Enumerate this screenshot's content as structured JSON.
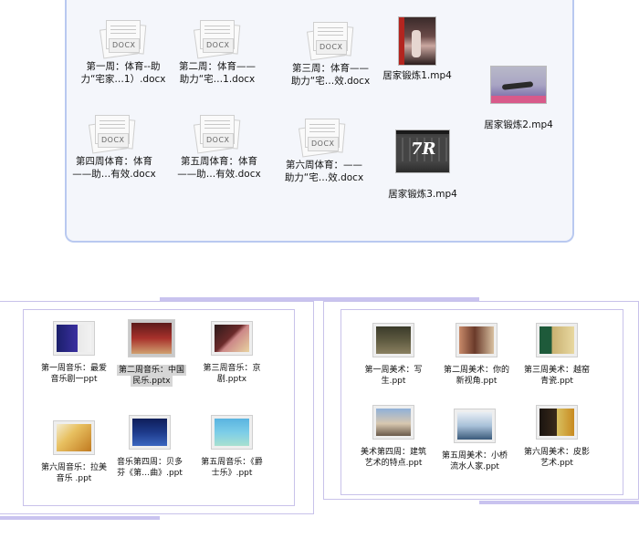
{
  "top_files": [
    {
      "name": "docx-file-week1",
      "tag": "DOCX",
      "label_line1": "第一周：体育--助",
      "label_line2": "力“宅家…1）.docx"
    },
    {
      "name": "docx-file-week2",
      "tag": "DOCX",
      "label_line1": "第二周：体育——",
      "label_line2": "助力“宅…1.docx"
    },
    {
      "name": "docx-file-week3",
      "tag": "DOCX",
      "label_line1": "第三周：体育——",
      "label_line2": "助力“宅…效.docx"
    },
    {
      "name": "docx-file-week4",
      "tag": "DOCX",
      "label_line1": "第四周体育：体育",
      "label_line2": "——助…有效.docx"
    },
    {
      "name": "docx-file-week5",
      "tag": "DOCX",
      "label_line1": "第五周体育：体育",
      "label_line2": "——助…有效.docx"
    },
    {
      "name": "docx-file-week6",
      "tag": "DOCX",
      "label_line1": "第六周体育：——",
      "label_line2": "助力“宅…效.docx"
    }
  ],
  "videos": [
    {
      "label": "居家锻炼1.mp4"
    },
    {
      "label": "居家锻炼2.mp4"
    },
    {
      "label": "居家锻炼3.mp4",
      "logo": "7R"
    }
  ],
  "music_files": [
    {
      "line1": "第一周音乐：最爱",
      "line2": "音乐剧一ppt"
    },
    {
      "line1": "第二周音乐：中国",
      "line2": "民乐.pptx"
    },
    {
      "line1": "第三周音乐：京",
      "line2": "剧.pptx"
    },
    {
      "line1": "第六周音乐：拉美",
      "line2": "音乐 .ppt"
    },
    {
      "line1": "音乐第四周：贝多",
      "line2": "芬《第…曲》.ppt"
    },
    {
      "line1": "第五周音乐：《爵",
      "line2": "士乐》.ppt"
    }
  ],
  "art_files": [
    {
      "line1": "第一周美术：写",
      "line2": "生.ppt"
    },
    {
      "line1": "第二周美术：你的",
      "line2": "新视角.ppt"
    },
    {
      "line1": "第三周美术：越窑",
      "line2": "青瓷.ppt"
    },
    {
      "line1": "美术第四周：建筑",
      "line2": "艺术的特点.ppt"
    },
    {
      "line1": "第五周美术：小桥",
      "line2": "流水人家.ppt"
    },
    {
      "line1": "第六周美术：皮影",
      "line2": "艺术.ppt"
    }
  ]
}
